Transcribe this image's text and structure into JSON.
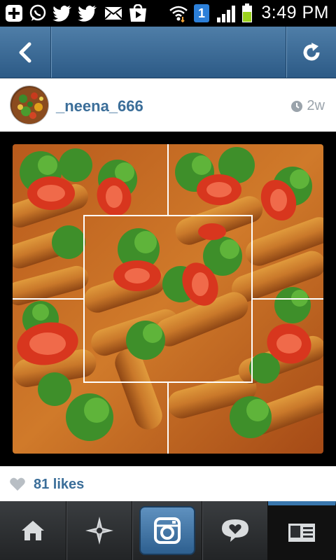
{
  "status_bar": {
    "time": "3:49 PM",
    "notification_count": "1",
    "icons": [
      "add-icon",
      "whatsapp-icon",
      "twitter-icon",
      "twitter-icon",
      "mail-icon",
      "play-store-icon",
      "wifi-icon",
      "notification-badge-icon",
      "signal-icon",
      "battery-icon"
    ]
  },
  "nav": {
    "back_icon": "chevron-left-icon",
    "refresh_icon": "refresh-icon"
  },
  "post": {
    "username": "_neena_666",
    "time_ago": "2w",
    "likes": "81 likes"
  },
  "tabs": [
    {
      "name": "home",
      "icon": "home-icon"
    },
    {
      "name": "explore",
      "icon": "explore-star-icon"
    },
    {
      "name": "camera",
      "icon": "camera-icon"
    },
    {
      "name": "news",
      "icon": "speech-heart-icon"
    },
    {
      "name": "profile",
      "icon": "profile-card-icon"
    }
  ],
  "colors": {
    "nav_blue": "#3b6b97",
    "username_blue": "#3b6e99",
    "tab_dark": "#2b2d30",
    "accent_tab": "#3a77ad"
  }
}
